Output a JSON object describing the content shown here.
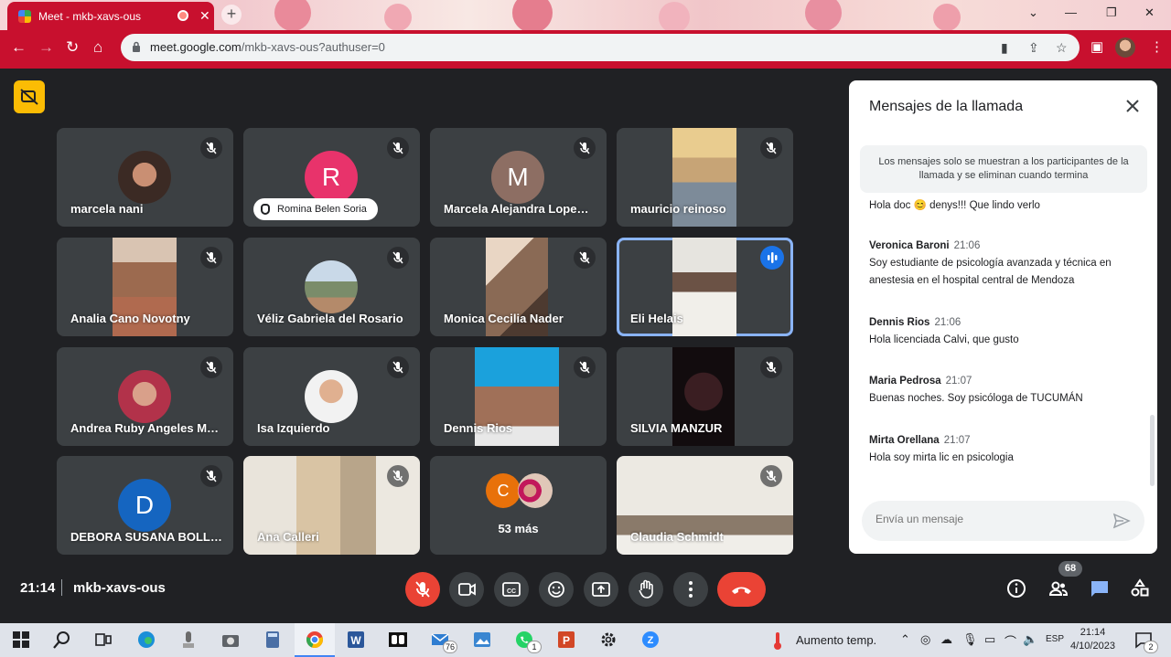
{
  "browser": {
    "tab_title": "Meet - mkb-xavs-ous",
    "url_host": "meet.google.com",
    "url_path": "/mkb-xavs-ous?authuser=0"
  },
  "tiles": [
    {
      "name": "marcela nani"
    },
    {
      "name": "Romina Belen Soria",
      "letter": "R"
    },
    {
      "name": "Marcela Alejandra Lope…",
      "letter": "M"
    },
    {
      "name": "mauricio reinoso"
    },
    {
      "name": "Analia Cano Novotny"
    },
    {
      "name": "Véliz Gabriela del Rosario"
    },
    {
      "name": "Monica Cecilia Nader"
    },
    {
      "name": "Eli Helais"
    },
    {
      "name": "Andrea Ruby Angeles M…"
    },
    {
      "name": "Isa Izquierdo"
    },
    {
      "name": "Dennis Rios"
    },
    {
      "name": "SILVIA MANZUR"
    },
    {
      "name": "DEBORA SUSANA BOLL…",
      "letter": "D"
    },
    {
      "name": "Ana Calleri"
    },
    {
      "name": "53 más",
      "letter": "C"
    },
    {
      "name": "Claudia Schmidt"
    }
  ],
  "chat": {
    "title": "Mensajes de la llamada",
    "notice": "Los mensajes solo se muestran a los participantes de la llamada y se eliminan cuando termina",
    "first_line": "Hola doc 😊 denys!!! Que lindo verlo",
    "messages": [
      {
        "sender": "Veronica Baroni",
        "time": "21:06",
        "text": "Soy estudiante de psicología avanzada y técnica en anestesia en el hospital central de Mendoza"
      },
      {
        "sender": "Dennis Rios",
        "time": "21:06",
        "text": "Hola licenciada Calvi, que gusto"
      },
      {
        "sender": "Maria Pedrosa",
        "time": "21:07",
        "text": "Buenas noches. Soy psicóloga de TUCUMÁN"
      },
      {
        "sender": "Mirta Orellana",
        "time": "21:07",
        "text": "Hola  soy mirta lic en psicologia"
      }
    ],
    "input_placeholder": "Envía un mensaje"
  },
  "meeting": {
    "time": "21:14",
    "code": "mkb-xavs-ous",
    "participant_count": "68"
  },
  "taskbar": {
    "weather": "Aumento temp.",
    "lang": "ESP",
    "clock_time": "21:14",
    "clock_date": "4/10/2023",
    "mail_count": "76",
    "whatsapp_count": "1",
    "notif_count": "2"
  },
  "colors": {
    "accent": "#c8102e",
    "meet_bg": "#202124",
    "tile_bg": "#3c4043",
    "red": "#ea4335",
    "blue": "#1a73e8"
  }
}
